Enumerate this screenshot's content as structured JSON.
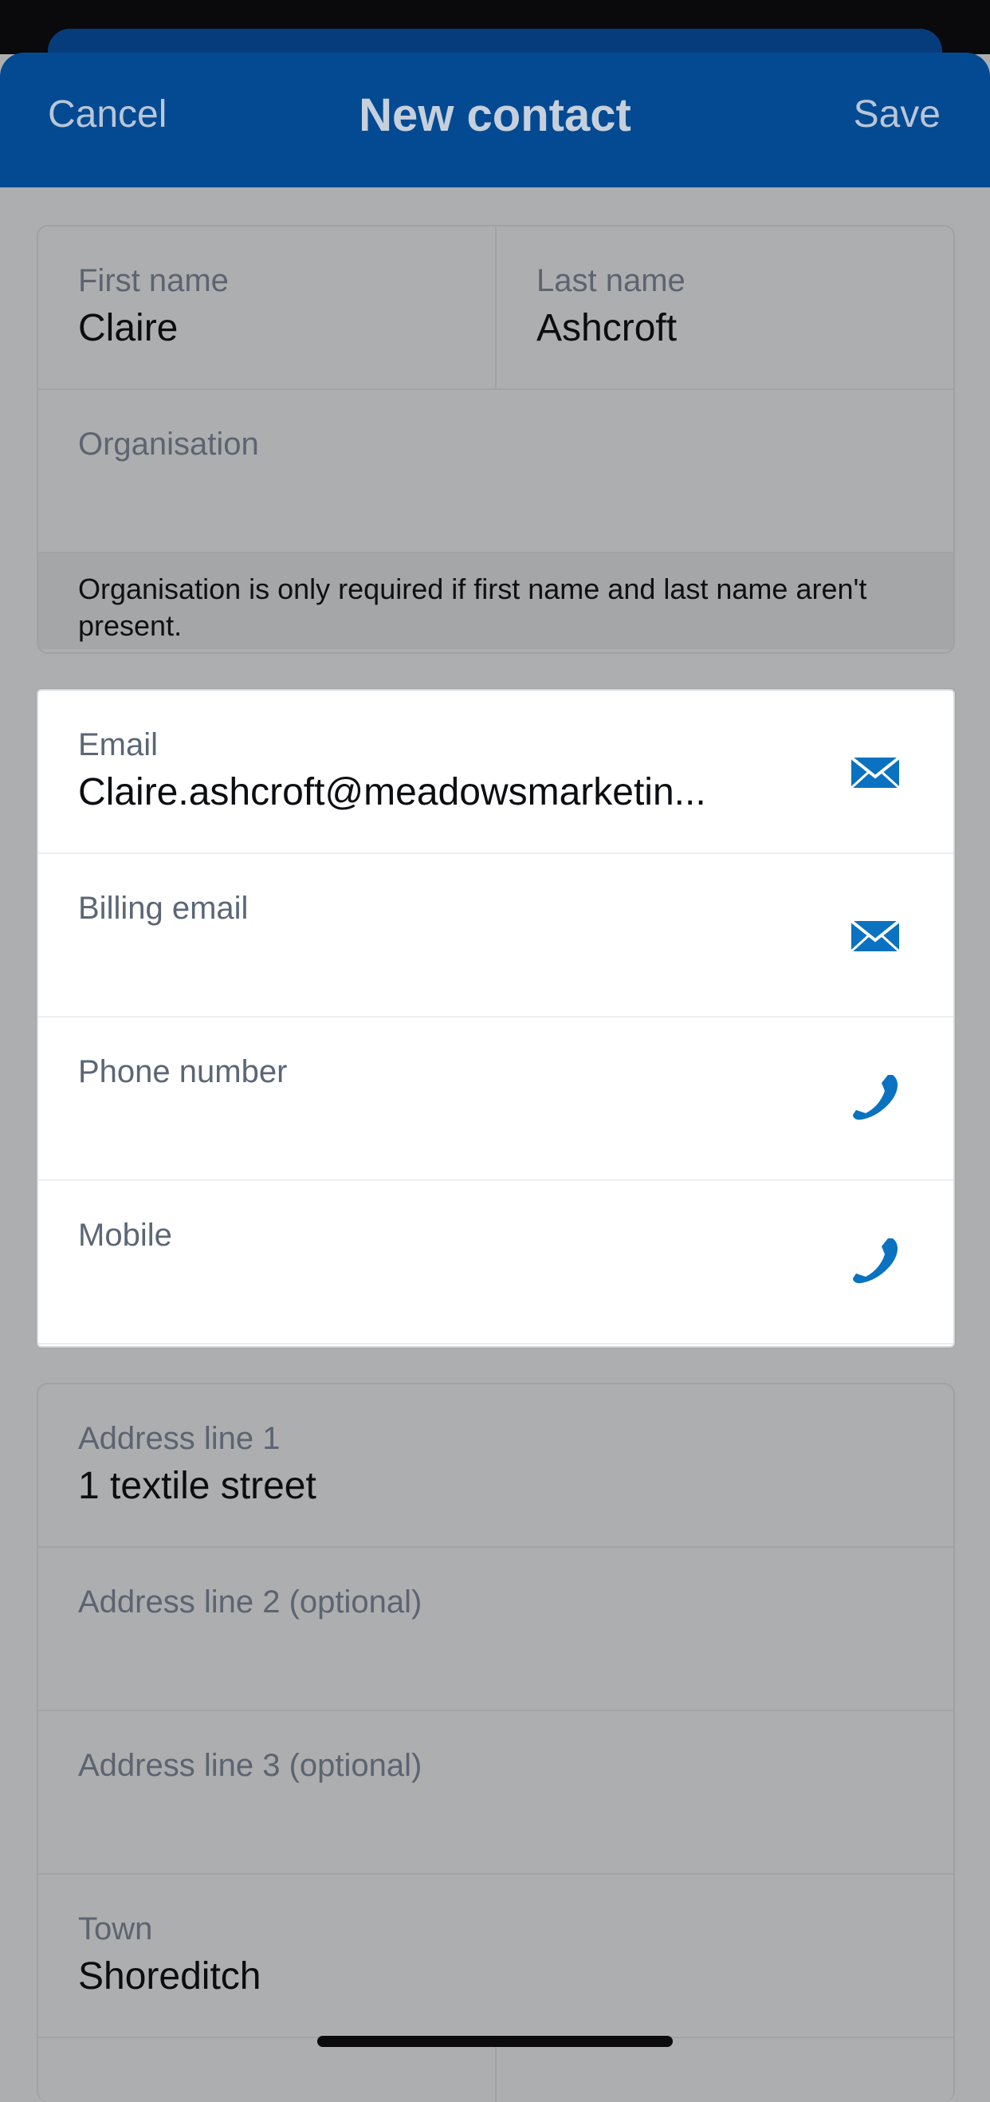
{
  "nav": {
    "cancel_label": "Cancel",
    "title": "New contact",
    "save_label": "Save",
    "bar_color": "#044a92"
  },
  "name_section": {
    "first_name_label": "First name",
    "first_name_value": "Claire",
    "last_name_label": "Last name",
    "last_name_value": "Ashcroft",
    "organisation_label": "Organisation",
    "organisation_value": "",
    "organisation_note": "Organisation is only required if first name and last name aren't present."
  },
  "contact_section": {
    "email_label": "Email",
    "email_value": "Claire.ashcroft@meadowsmarketin...",
    "email_icon": "envelope-icon",
    "billing_email_label": "Billing email",
    "billing_email_value": "",
    "billing_email_icon": "envelope-icon",
    "phone_label": "Phone number",
    "phone_value": "",
    "phone_icon": "phone-icon",
    "mobile_label": "Mobile",
    "mobile_value": "",
    "mobile_icon": "phone-icon",
    "icon_color": "#0a72c0"
  },
  "address_section": {
    "line1_label": "Address line 1",
    "line1_value": "1 textile street",
    "line2_label": "Address line 2 (optional)",
    "line2_value": "",
    "line3_label": "Address line 3 (optional)",
    "line3_value": "",
    "town_label": "Town",
    "town_value": "Shoreditch"
  }
}
